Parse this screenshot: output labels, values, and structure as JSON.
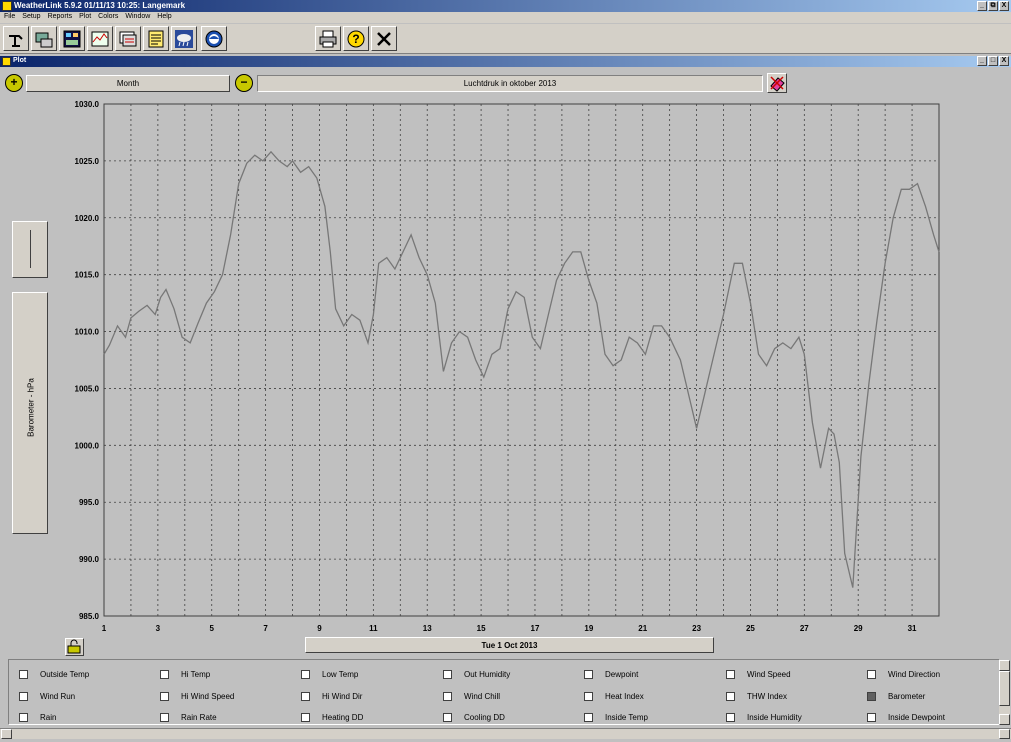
{
  "app": {
    "title": "WeatherLink 5.9.2  01/11/13  10:25: Langemark",
    "window_buttons": [
      "_",
      "⧉",
      "X"
    ]
  },
  "menu": [
    "File",
    "Setup",
    "Reports",
    "Plot",
    "Colors",
    "Window",
    "Help"
  ],
  "toolbar": {
    "buttons": [
      "station-icon",
      "console-icon",
      "bulletin-icon",
      "strip-chart-icon",
      "browse-icon",
      "notes-icon",
      "weather-icon",
      "noaa-icon"
    ],
    "right_buttons": [
      "print-icon",
      "help-icon",
      "close-icon"
    ]
  },
  "plot_window": {
    "title": "Plot",
    "window_buttons": [
      "_",
      "□",
      "X"
    ],
    "period": "Month",
    "plot_title": "Luchtdruk in oktober 2013",
    "y_label": "Barometer - hPa",
    "date": "Tue 1 Oct 2013"
  },
  "legend": {
    "rows": [
      [
        {
          "label": "Outside Temp",
          "on": false
        },
        {
          "label": "Hi Temp",
          "on": false
        },
        {
          "label": "Low Temp",
          "on": false
        },
        {
          "label": "Out Humidity",
          "on": false
        },
        {
          "label": "Dewpoint",
          "on": false
        },
        {
          "label": "Wind Speed",
          "on": false
        },
        {
          "label": "Wind Direction",
          "on": false
        }
      ],
      [
        {
          "label": "Wind Run",
          "on": false
        },
        {
          "label": "Hi Wind Speed",
          "on": false
        },
        {
          "label": "Hi Wind Dir",
          "on": false
        },
        {
          "label": "Wind Chill",
          "on": false
        },
        {
          "label": "Heat Index",
          "on": false
        },
        {
          "label": "THW Index",
          "on": false
        },
        {
          "label": "Barometer",
          "on": true
        }
      ],
      [
        {
          "label": "Rain",
          "on": false
        },
        {
          "label": "Rain Rate",
          "on": false
        },
        {
          "label": "Heating DD",
          "on": false
        },
        {
          "label": "Cooling DD",
          "on": false
        },
        {
          "label": "Inside Temp",
          "on": false
        },
        {
          "label": "Inside Humidity",
          "on": false
        },
        {
          "label": "Inside Dewpoint",
          "on": false
        }
      ]
    ]
  },
  "chart_data": {
    "type": "line",
    "title": "Luchtdruk in oktober 2013",
    "xlabel": "Tue 1 Oct 2013",
    "ylabel": "Barometer - hPa",
    "ylim": [
      985.0,
      1030.0
    ],
    "xlim": [
      1,
      32
    ],
    "yticks": [
      "1030.0",
      "1025.0",
      "1020.0",
      "1015.0",
      "1010.0",
      "1005.0",
      "1000.0",
      "995.0",
      "990.0",
      "985.0"
    ],
    "xticks": [
      "1",
      "3",
      "5",
      "7",
      "9",
      "11",
      "13",
      "15",
      "17",
      "19",
      "21",
      "23",
      "25",
      "27",
      "29",
      "31"
    ],
    "grid": true,
    "line_color": "#777777",
    "series": [
      {
        "x": [
          1,
          1.2,
          1.5,
          1.8,
          2.0,
          2.3,
          2.6,
          2.9,
          3.1,
          3.3,
          3.6,
          3.9,
          4.2,
          4.5,
          4.8,
          5.1,
          5.4,
          5.7,
          6.0,
          6.3,
          6.6,
          6.9,
          7.2,
          7.5,
          7.8,
          8.0,
          8.3,
          8.6,
          8.9,
          9.2,
          9.4,
          9.6,
          9.9,
          10.2,
          10.5,
          10.8,
          11.0,
          11.2,
          11.5,
          11.8,
          12.1,
          12.4,
          12.7,
          13.0,
          13.3,
          13.6,
          13.9,
          14.2,
          14.5,
          14.8,
          15.1,
          15.4,
          15.7,
          16.0,
          16.3,
          16.6,
          16.9,
          17.2,
          17.5,
          17.8,
          18.1,
          18.4,
          18.7,
          19.0,
          19.3,
          19.6,
          19.9,
          20.2,
          20.5,
          20.8,
          21.1,
          21.4,
          21.7,
          22.0,
          22.4,
          22.7,
          23.0,
          23.5,
          24.0,
          24.4,
          24.7,
          25.0,
          25.3,
          25.6,
          25.9,
          26.2,
          26.5,
          26.8,
          27.0,
          27.3,
          27.6,
          27.9,
          28.1,
          28.3,
          28.5,
          28.8,
          29.1,
          29.4,
          29.7,
          30.0,
          30.3,
          30.6,
          30.9,
          31.2,
          31.5,
          31.8,
          32.0
        ],
        "y": [
          1008.0,
          1008.8,
          1010.5,
          1009.5,
          1011.2,
          1011.8,
          1012.3,
          1011.5,
          1013.0,
          1013.7,
          1012.0,
          1009.5,
          1009.0,
          1010.8,
          1012.5,
          1013.5,
          1015.0,
          1018.5,
          1023.0,
          1024.8,
          1025.5,
          1025.0,
          1025.8,
          1025.0,
          1024.5,
          1025.0,
          1024.0,
          1024.5,
          1023.5,
          1021.0,
          1017.0,
          1012.0,
          1010.5,
          1011.5,
          1011.0,
          1009.0,
          1011.5,
          1016.0,
          1016.5,
          1015.5,
          1017.0,
          1018.5,
          1016.5,
          1015.0,
          1012.5,
          1006.5,
          1009.0,
          1010.0,
          1009.5,
          1007.5,
          1006.0,
          1008.0,
          1008.5,
          1012.0,
          1013.5,
          1013.0,
          1009.5,
          1008.5,
          1011.5,
          1014.5,
          1016.0,
          1017.0,
          1017.0,
          1014.5,
          1012.5,
          1008.0,
          1007.0,
          1007.5,
          1009.5,
          1009.0,
          1008.0,
          1010.5,
          1010.5,
          1009.5,
          1007.5,
          1004.5,
          1001.5,
          1006.5,
          1011.5,
          1016.0,
          1016.0,
          1012.5,
          1008.0,
          1007.0,
          1008.5,
          1009.0,
          1008.5,
          1009.5,
          1008.0,
          1002.0,
          998.0,
          1001.5,
          1001.0,
          998.5,
          990.5,
          987.5,
          999.0,
          1005.5,
          1011.0,
          1016.0,
          1020.0,
          1022.5,
          1022.5,
          1023.0,
          1021.0,
          1018.5,
          1017.0
        ]
      }
    ]
  }
}
